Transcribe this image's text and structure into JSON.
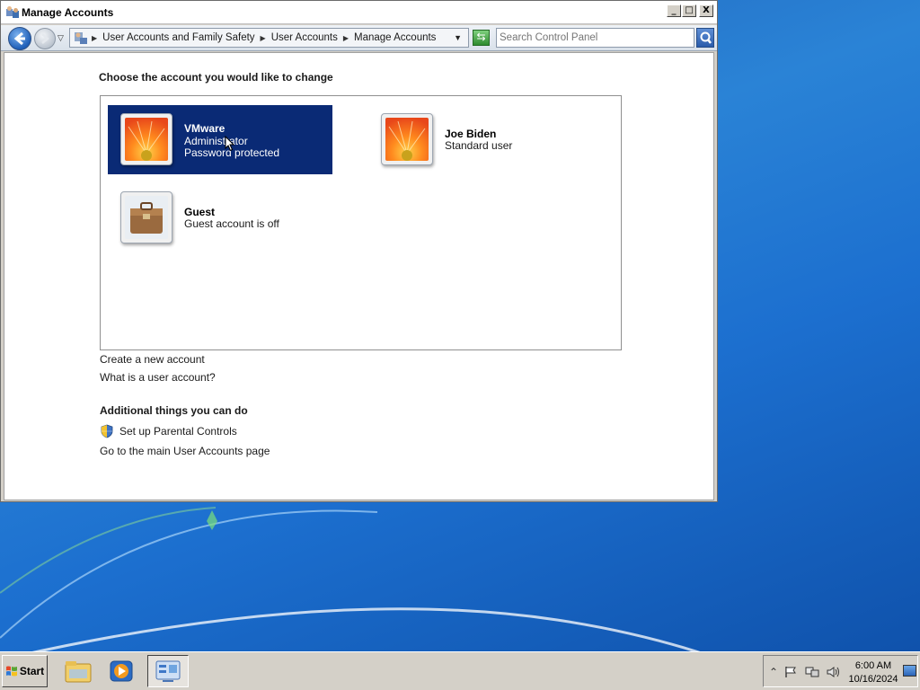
{
  "window": {
    "title": "Manage Accounts",
    "controls": {
      "minimize": "_",
      "maximize": "□",
      "close": "X"
    }
  },
  "addressbar": {
    "breadcrumbs": [
      "User Accounts and Family Safety",
      "User Accounts",
      "Manage Accounts"
    ],
    "search": {
      "placeholder": "Search Control Panel",
      "value": ""
    }
  },
  "main": {
    "choose_heading": "Choose the account you would like to change",
    "accounts": [
      {
        "name": "VMware",
        "lines": [
          "Administrator",
          "Password protected"
        ],
        "selected": true,
        "avatar": "flower-avatar"
      },
      {
        "name": "Joe Biden",
        "lines": [
          "Standard user"
        ],
        "selected": false,
        "avatar": "flower-avatar"
      },
      {
        "name": "Guest",
        "lines": [
          "Guest account is off"
        ],
        "selected": false,
        "avatar": "briefcase-avatar"
      }
    ],
    "links": {
      "create_account": "Create a new account",
      "what_is_account": "What is a user account?"
    },
    "additional_heading": "Additional things you can do",
    "additional_links": {
      "parental_controls": "Set up Parental Controls",
      "main_page": "Go to the main User Accounts page"
    }
  },
  "taskbar": {
    "start_label": "Start",
    "pinned": [
      "explorer-icon",
      "media-player-icon",
      "control-panel-icon"
    ],
    "clock": {
      "time": "6:00 AM",
      "date": "10/16/2024"
    }
  },
  "colors": {
    "selection": "#0a2a75",
    "desktop": "#1c6fcf",
    "chrome": "#d4d0c8"
  }
}
